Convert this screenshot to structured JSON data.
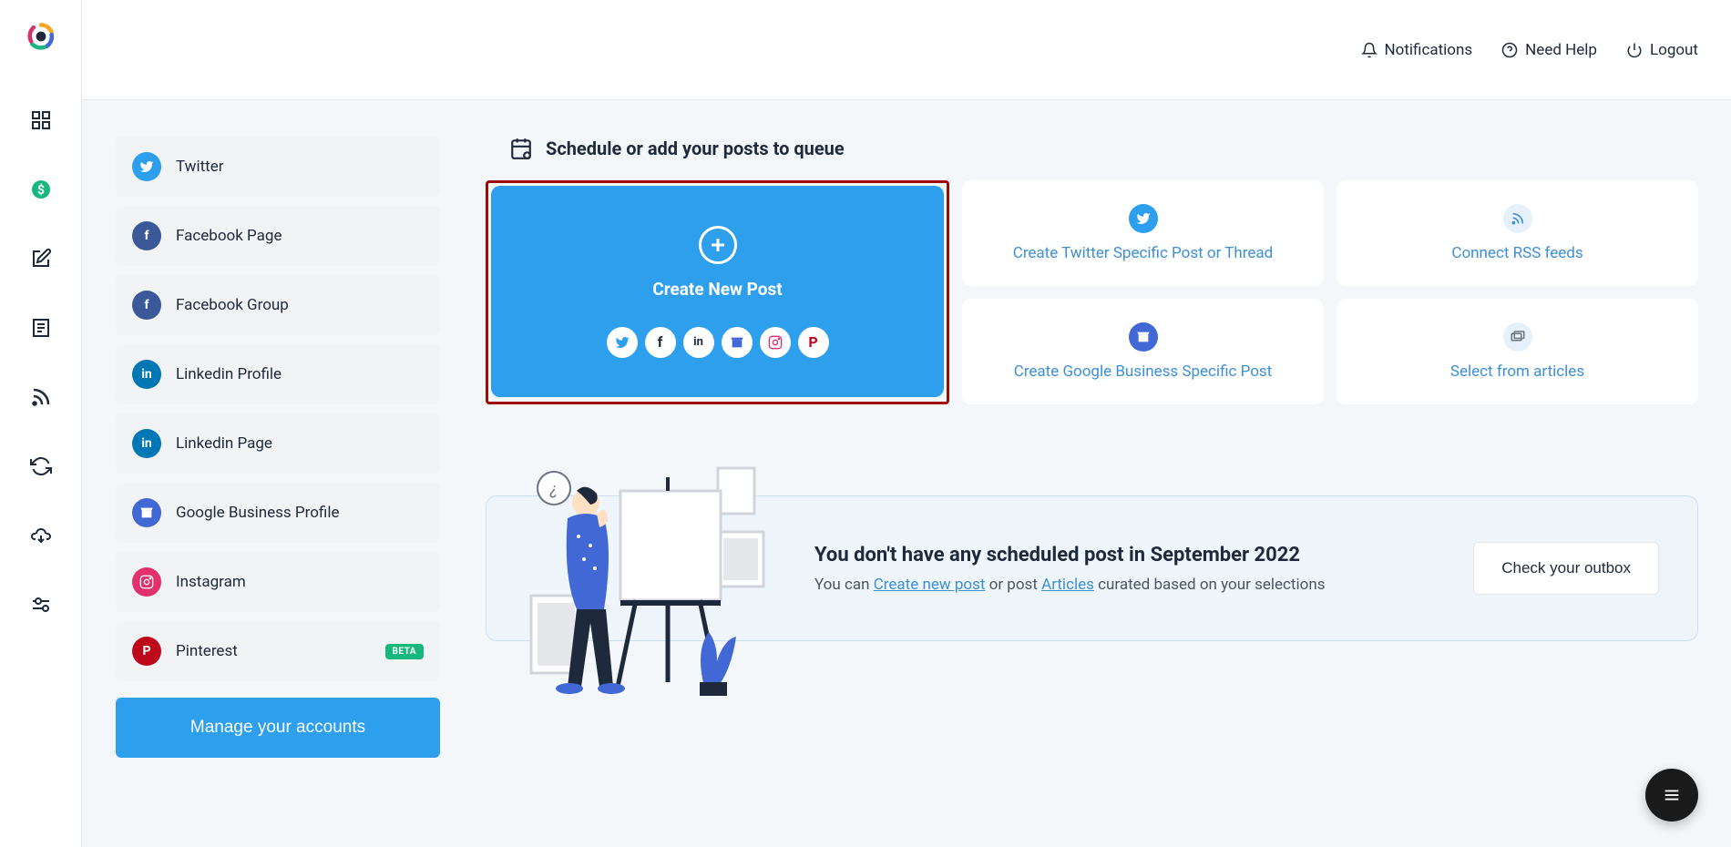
{
  "header": {
    "notifications": "Notifications",
    "help": "Need Help",
    "logout": "Logout"
  },
  "sidebar": {
    "accounts": [
      {
        "label": "Twitter",
        "bg": "#2d9fed",
        "icon": "twitter"
      },
      {
        "label": "Facebook Page",
        "bg": "#3b5998",
        "icon": "facebook"
      },
      {
        "label": "Facebook Group",
        "bg": "#3b5998",
        "icon": "facebook"
      },
      {
        "label": "Linkedin Profile",
        "bg": "#0077b5",
        "icon": "linkedin"
      },
      {
        "label": "Linkedin Page",
        "bg": "#0077b5",
        "icon": "linkedin"
      },
      {
        "label": "Google Business Profile",
        "bg": "#4268d6",
        "icon": "google-business"
      },
      {
        "label": "Instagram",
        "bg": "#e1306c",
        "icon": "instagram"
      },
      {
        "label": "Pinterest",
        "bg": "#bd081c",
        "icon": "pinterest",
        "beta": "BETA"
      }
    ],
    "manage": "Manage your accounts"
  },
  "section_title": "Schedule or add your posts to queue",
  "big_card": {
    "title": "Create New Post",
    "platforms": [
      "twitter",
      "facebook",
      "linkedin",
      "google-business",
      "instagram",
      "pinterest"
    ]
  },
  "small_cards": [
    {
      "icon": "twitter",
      "label": "Create Twitter Specific Post or Thread"
    },
    {
      "icon": "rss",
      "label": "Connect RSS feeds"
    },
    {
      "icon": "google-business",
      "label": "Create Google Business Specific Post"
    },
    {
      "icon": "articles",
      "label": "Select from articles"
    }
  ],
  "empty": {
    "title": "You don't have any scheduled post in September 2022",
    "sub_prefix": "You can ",
    "link1": "Create new post",
    "sub_mid": " or post ",
    "link2": "Articles",
    "sub_suffix": " curated based on your selections",
    "outbox": "Check your outbox"
  }
}
